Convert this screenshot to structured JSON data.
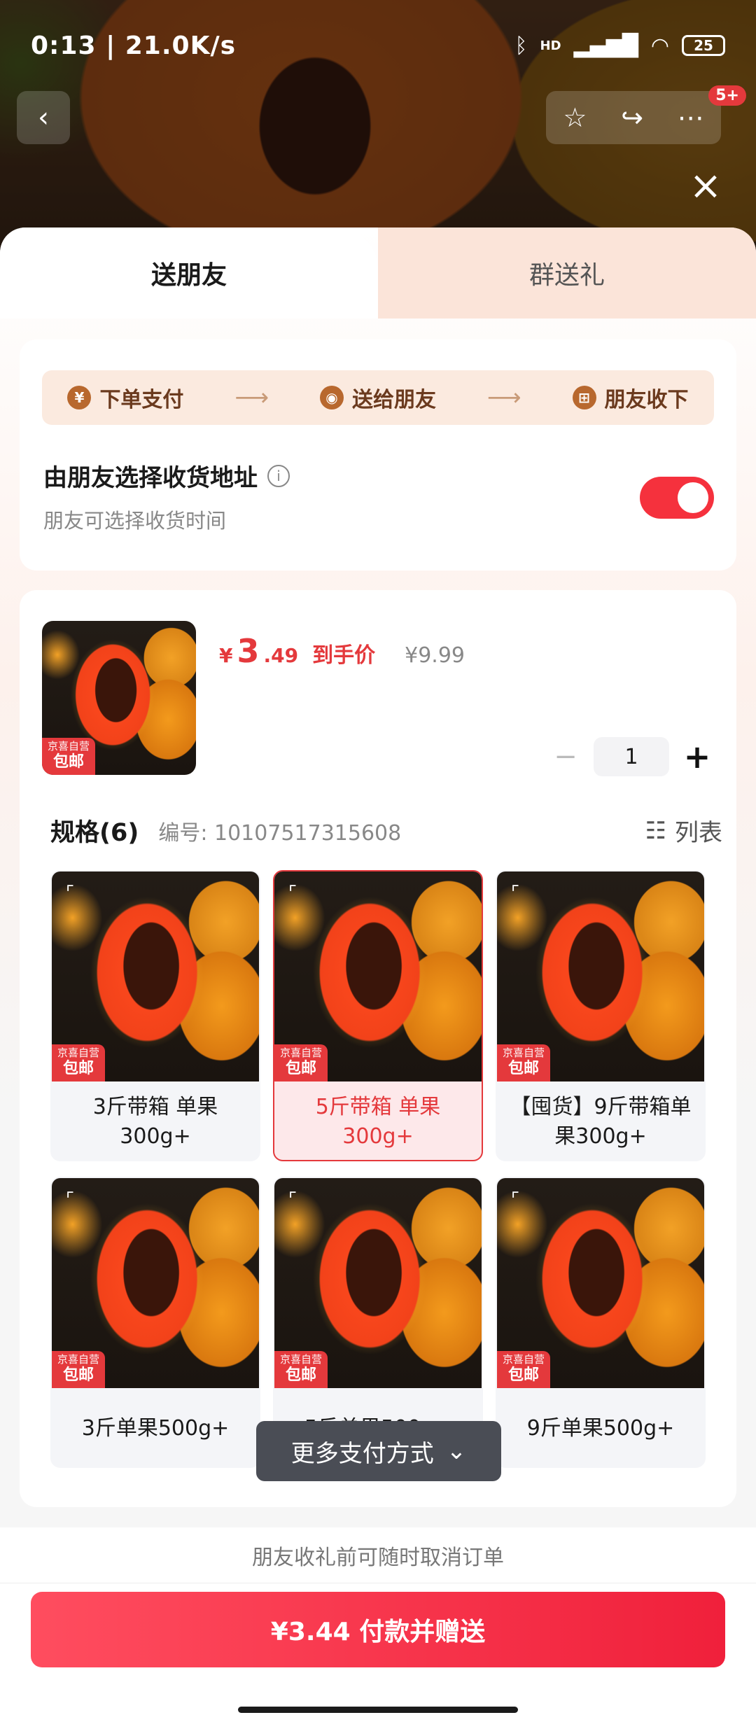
{
  "status_bar": {
    "time": "0:13 | 21.0K/s",
    "bluetooth_icon": "bluetooth-icon",
    "signal_label": "HD",
    "battery": "25"
  },
  "nav": {
    "badge": "5+",
    "back_icon": "chevron-left-icon",
    "star_icon": "star-icon",
    "share_icon": "share-icon",
    "more_icon": "more-icon",
    "close_icon": "close-icon"
  },
  "tabs": [
    {
      "label": "送朋友",
      "active": true
    },
    {
      "label": "群送礼",
      "active": false
    }
  ],
  "gift_flow": {
    "steps": [
      {
        "icon": "¥",
        "label": "下单支付"
      },
      {
        "icon": "◉",
        "label": "送给朋友"
      },
      {
        "icon": "⊞",
        "label": "朋友收下"
      }
    ],
    "arrow": "⟶",
    "address_title": "由朋友选择收货地址",
    "info_icon": "i",
    "address_sub": "朋友可选择收货时间",
    "toggle_on": true
  },
  "product": {
    "price_symbol": "¥",
    "price_int": "3",
    "price_dec": ".49",
    "price_label": "到手价",
    "original_price": "¥9.99",
    "tag_top": "京喜自营",
    "tag_bottom": "包邮",
    "quantity": "1",
    "minus": "−",
    "plus": "+"
  },
  "spec": {
    "title": "规格(6)",
    "code": "编号: 10107517315608",
    "list_label": "列表",
    "items": [
      {
        "name": "3斤带箱 单果300g+",
        "selected": false
      },
      {
        "name": "5斤带箱 单果300g+",
        "selected": true
      },
      {
        "name": "【囤货】9斤带箱单果300g+",
        "selected": false
      },
      {
        "name": "3斤单果500g+",
        "selected": false
      },
      {
        "name": "5斤单果500g+",
        "selected": false
      },
      {
        "name": "9斤单果500g+",
        "selected": false
      }
    ]
  },
  "more_pay": {
    "label": "更多支付方式",
    "icon": "chevron-double-down-icon"
  },
  "bottom": {
    "hint": "朋友收礼前可随时取消订单",
    "pay_label": "¥3.44 付款并赠送"
  },
  "colors": {
    "accent": "#e4393c",
    "step_bg": "#fbeadf",
    "tab_inactive": "#fbe4d9"
  }
}
